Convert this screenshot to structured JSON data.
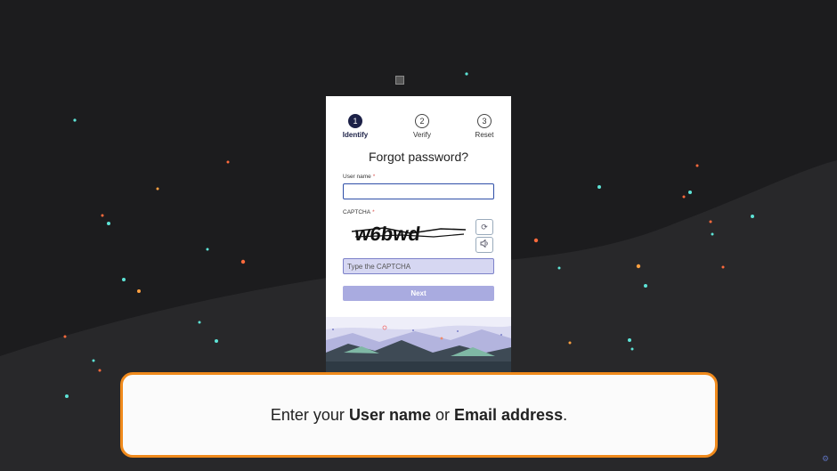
{
  "steps": [
    {
      "number": "1",
      "label": "Identify",
      "active": true
    },
    {
      "number": "2",
      "label": "Verify",
      "active": false
    },
    {
      "number": "3",
      "label": "Reset",
      "active": false
    }
  ],
  "form": {
    "title": "Forgot password?",
    "username_label": "User name",
    "username_value": "",
    "required_mark": "*",
    "captcha_label": "CAPTCHA",
    "captcha_text": "w6bwd",
    "captcha_placeholder": "Type the CAPTCHA",
    "next_label": "Next"
  },
  "callout": {
    "prefix": "Enter your ",
    "bold1": "User name",
    "middle": " or ",
    "bold2": "Email address",
    "suffix": "."
  },
  "icons": {
    "refresh": "refresh-icon",
    "audio": "speaker-icon",
    "corner": "settings-icon"
  },
  "colors": {
    "background": "#1c1c1e",
    "step_active": "#1c2147",
    "input_focus_border": "#2f4fa8",
    "captcha_input_bg": "#d6d7f2",
    "next_button": "#a9abe0",
    "callout_border": "#f08a1c"
  }
}
